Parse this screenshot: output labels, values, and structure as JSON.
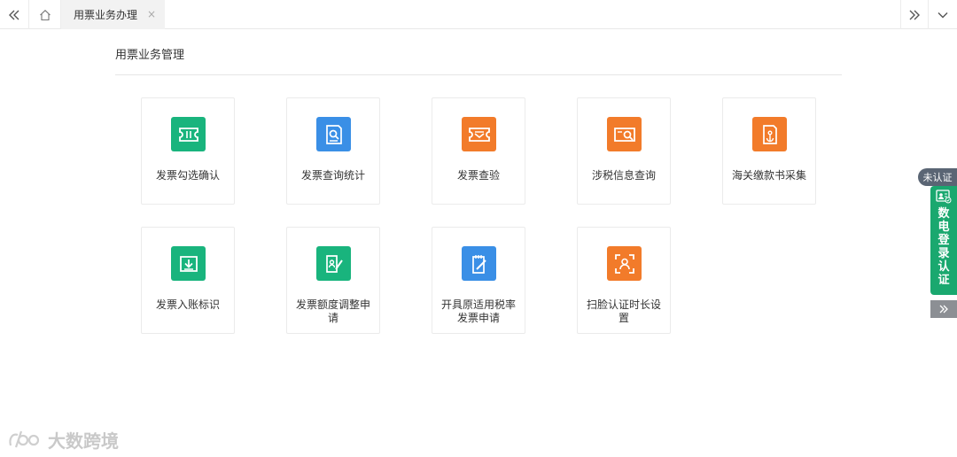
{
  "tabbar": {
    "active_tab": "用票业务办理",
    "close_glyph": "×"
  },
  "main": {
    "section_title": "用票业务管理",
    "cards": [
      {
        "label": "发票勾选确认",
        "icon": "ticket-icon",
        "color": "#19b47d"
      },
      {
        "label": "发票查询统计",
        "icon": "document-search-icon",
        "color": "#3a8fe6"
      },
      {
        "label": "发票查验",
        "icon": "ticket-check-icon",
        "color": "#f27b2a"
      },
      {
        "label": "涉税信息查询",
        "icon": "card-search-icon",
        "color": "#f27b2a"
      },
      {
        "label": "海关缴款书采集",
        "icon": "document-anchor-icon",
        "color": "#f27b2a"
      },
      {
        "label": "发票入账标识",
        "icon": "tray-download-icon",
        "color": "#19b47d"
      },
      {
        "label": "发票额度调整申请",
        "icon": "edit-document-icon",
        "color": "#19b47d"
      },
      {
        "label": "开具原适用税率发票申请",
        "icon": "notepad-pen-icon",
        "color": "#3a8fe6"
      },
      {
        "label": "扫脸认证时长设置",
        "icon": "face-scan-icon",
        "color": "#f27b2a"
      }
    ]
  },
  "side_panel": {
    "badge": "未认证",
    "label": "数电登录认证"
  },
  "watermark": {
    "text": "大数跨境"
  }
}
